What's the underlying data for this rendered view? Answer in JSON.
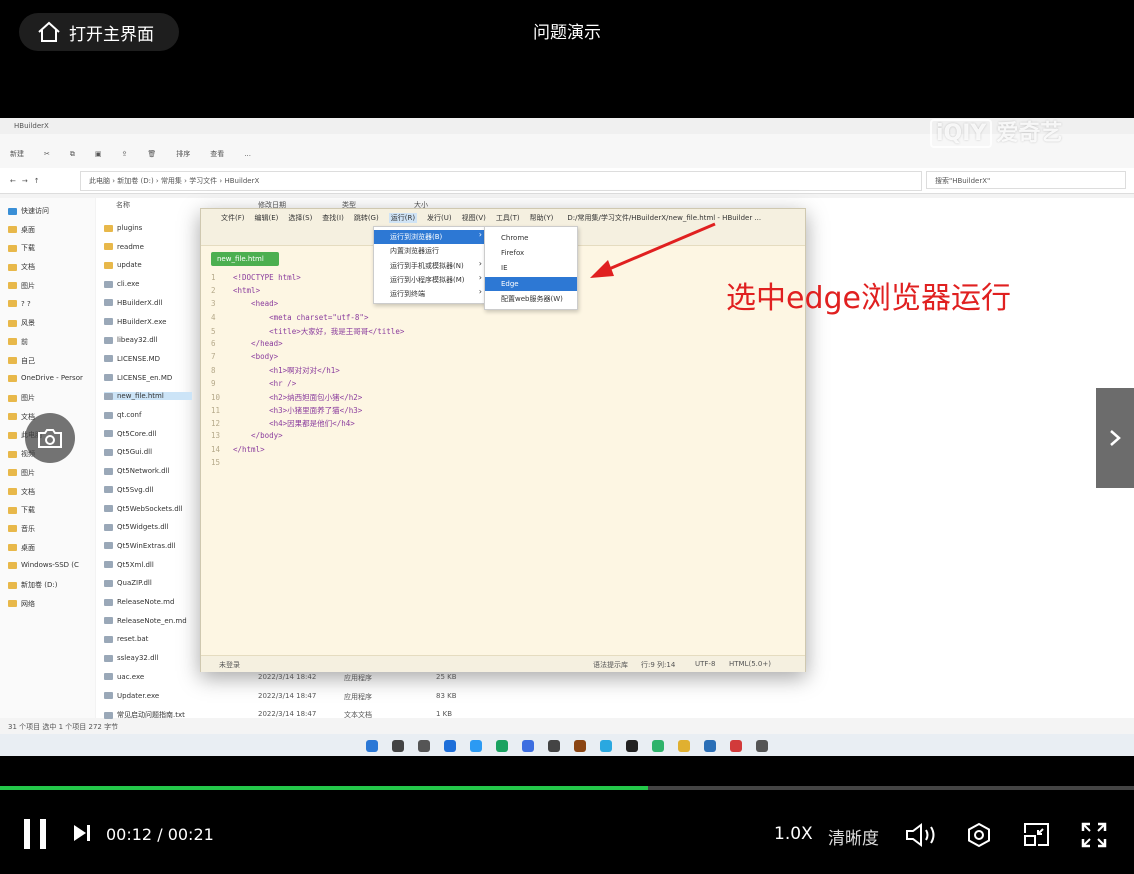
{
  "player": {
    "home_label": "打开主界面",
    "title": "问题演示",
    "time_current": "00:12",
    "time_separator": "/",
    "time_total": "00:21",
    "progress": 0.571,
    "speed_label": "1.0X",
    "quality_label": "清晰度",
    "accent_color": "#24c84a"
  },
  "watermark": {
    "box": "iQIY",
    "text": "爱奇艺"
  },
  "annotation": {
    "text": "选中edge浏览器运行",
    "color": "#e02020"
  },
  "explorer": {
    "title": "HBuilderX",
    "toolbar": [
      "新建",
      "排序",
      "查看",
      "..."
    ],
    "address": [
      "此电脑",
      "新加卷 (D:)",
      "常用集",
      "学习文件",
      "HBuilderX"
    ],
    "search_placeholder": "搜索\"HBuilderX\"",
    "columns": {
      "name": "名称",
      "date": "修改日期",
      "type": "类型",
      "size": "大小"
    },
    "nav": [
      "快速访问",
      "桌面",
      "下载",
      "文档",
      "图片",
      "? ?",
      "风景",
      "前",
      "自己",
      "OneDrive - Persor",
      "图片",
      "文档",
      "此电脑",
      "视频",
      "图片",
      "文档",
      "下载",
      "音乐",
      "桌面",
      "Windows-SSD (C",
      "新加卷 (D:)",
      "网络"
    ],
    "files": [
      "plugins",
      "readme",
      "update",
      "cli.exe",
      "HBuilderX.dll",
      "HBuilderX.exe",
      "libeay32.dll",
      "LICENSE.MD",
      "LICENSE_en.MD",
      "new_file.html",
      "qt.conf",
      "Qt5Core.dll",
      "Qt5Gui.dll",
      "Qt5Network.dll",
      "Qt5Svg.dll",
      "Qt5WebSockets.dll",
      "Qt5Widgets.dll",
      "Qt5WinExtras.dll",
      "Qt5Xml.dll",
      "QuaZIP.dll",
      "ReleaseNote.md",
      "ReleaseNote_en.md",
      "reset.bat",
      "ssleay32.dll",
      "uac.exe",
      "Updater.exe",
      "常见启动问题指南.txt"
    ],
    "bottom_rows": [
      {
        "date": "2022/3/14 18:42",
        "type": "应用程序",
        "size": "25 KB"
      },
      {
        "date": "2022/3/14 18:47",
        "type": "应用程序",
        "size": "83 KB"
      },
      {
        "date": "2022/3/14 18:47",
        "type": "文本文档",
        "size": "1 KB"
      }
    ],
    "status": "31 个项目   选中 1 个项目  272 字节"
  },
  "hbuilder": {
    "menus": [
      "文件(F)",
      "编辑(E)",
      "选择(S)",
      "查找(I)",
      "跳转(G)",
      "运行(R)",
      "发行(U)",
      "视图(V)",
      "工具(T)",
      "帮助(Y)"
    ],
    "path": "D:/常用集/学习文件/HBuilderX/new_file.html - HBuilder ...",
    "tab": "new_file.html",
    "code": [
      {
        "n": "1",
        "t": "<!DOCTYPE html>"
      },
      {
        "n": "2",
        "t": "<html>"
      },
      {
        "n": "3",
        "t": "    <head>"
      },
      {
        "n": "4",
        "t": "        <meta charset=\"utf-8\">"
      },
      {
        "n": "5",
        "t": "        <title>大家好，我是王哥哥</title>"
      },
      {
        "n": "6",
        "t": "    </head>"
      },
      {
        "n": "7",
        "t": "    <body>"
      },
      {
        "n": "8",
        "t": "        <h1>啊对对对</h1>"
      },
      {
        "n": "9",
        "t": "        <hr />"
      },
      {
        "n": "10",
        "t": "        <h2>纳西妲面包小猪</h2>"
      },
      {
        "n": "11",
        "t": "        <h3>小猪里面养了猫</h3>"
      },
      {
        "n": "12",
        "t": "        <h4>因果都是他们</h4>"
      },
      {
        "n": "13",
        "t": "    </body>"
      },
      {
        "n": "14",
        "t": "</html>"
      },
      {
        "n": "15",
        "t": ""
      }
    ],
    "run_menu": [
      "运行到浏览器(B)",
      "内置浏览器运行",
      "运行到手机或模拟器(N)",
      "运行到小程序模拟器(M)",
      "运行到终端"
    ],
    "browser_menu": [
      "Chrome",
      "Firefox",
      "IE",
      "Edge",
      "配置web服务器(W)"
    ],
    "status_left": "未登录",
    "status_right": [
      "语法提示库",
      "行:9  列:14",
      "UTF-8",
      "HTML(5.0+)"
    ]
  }
}
